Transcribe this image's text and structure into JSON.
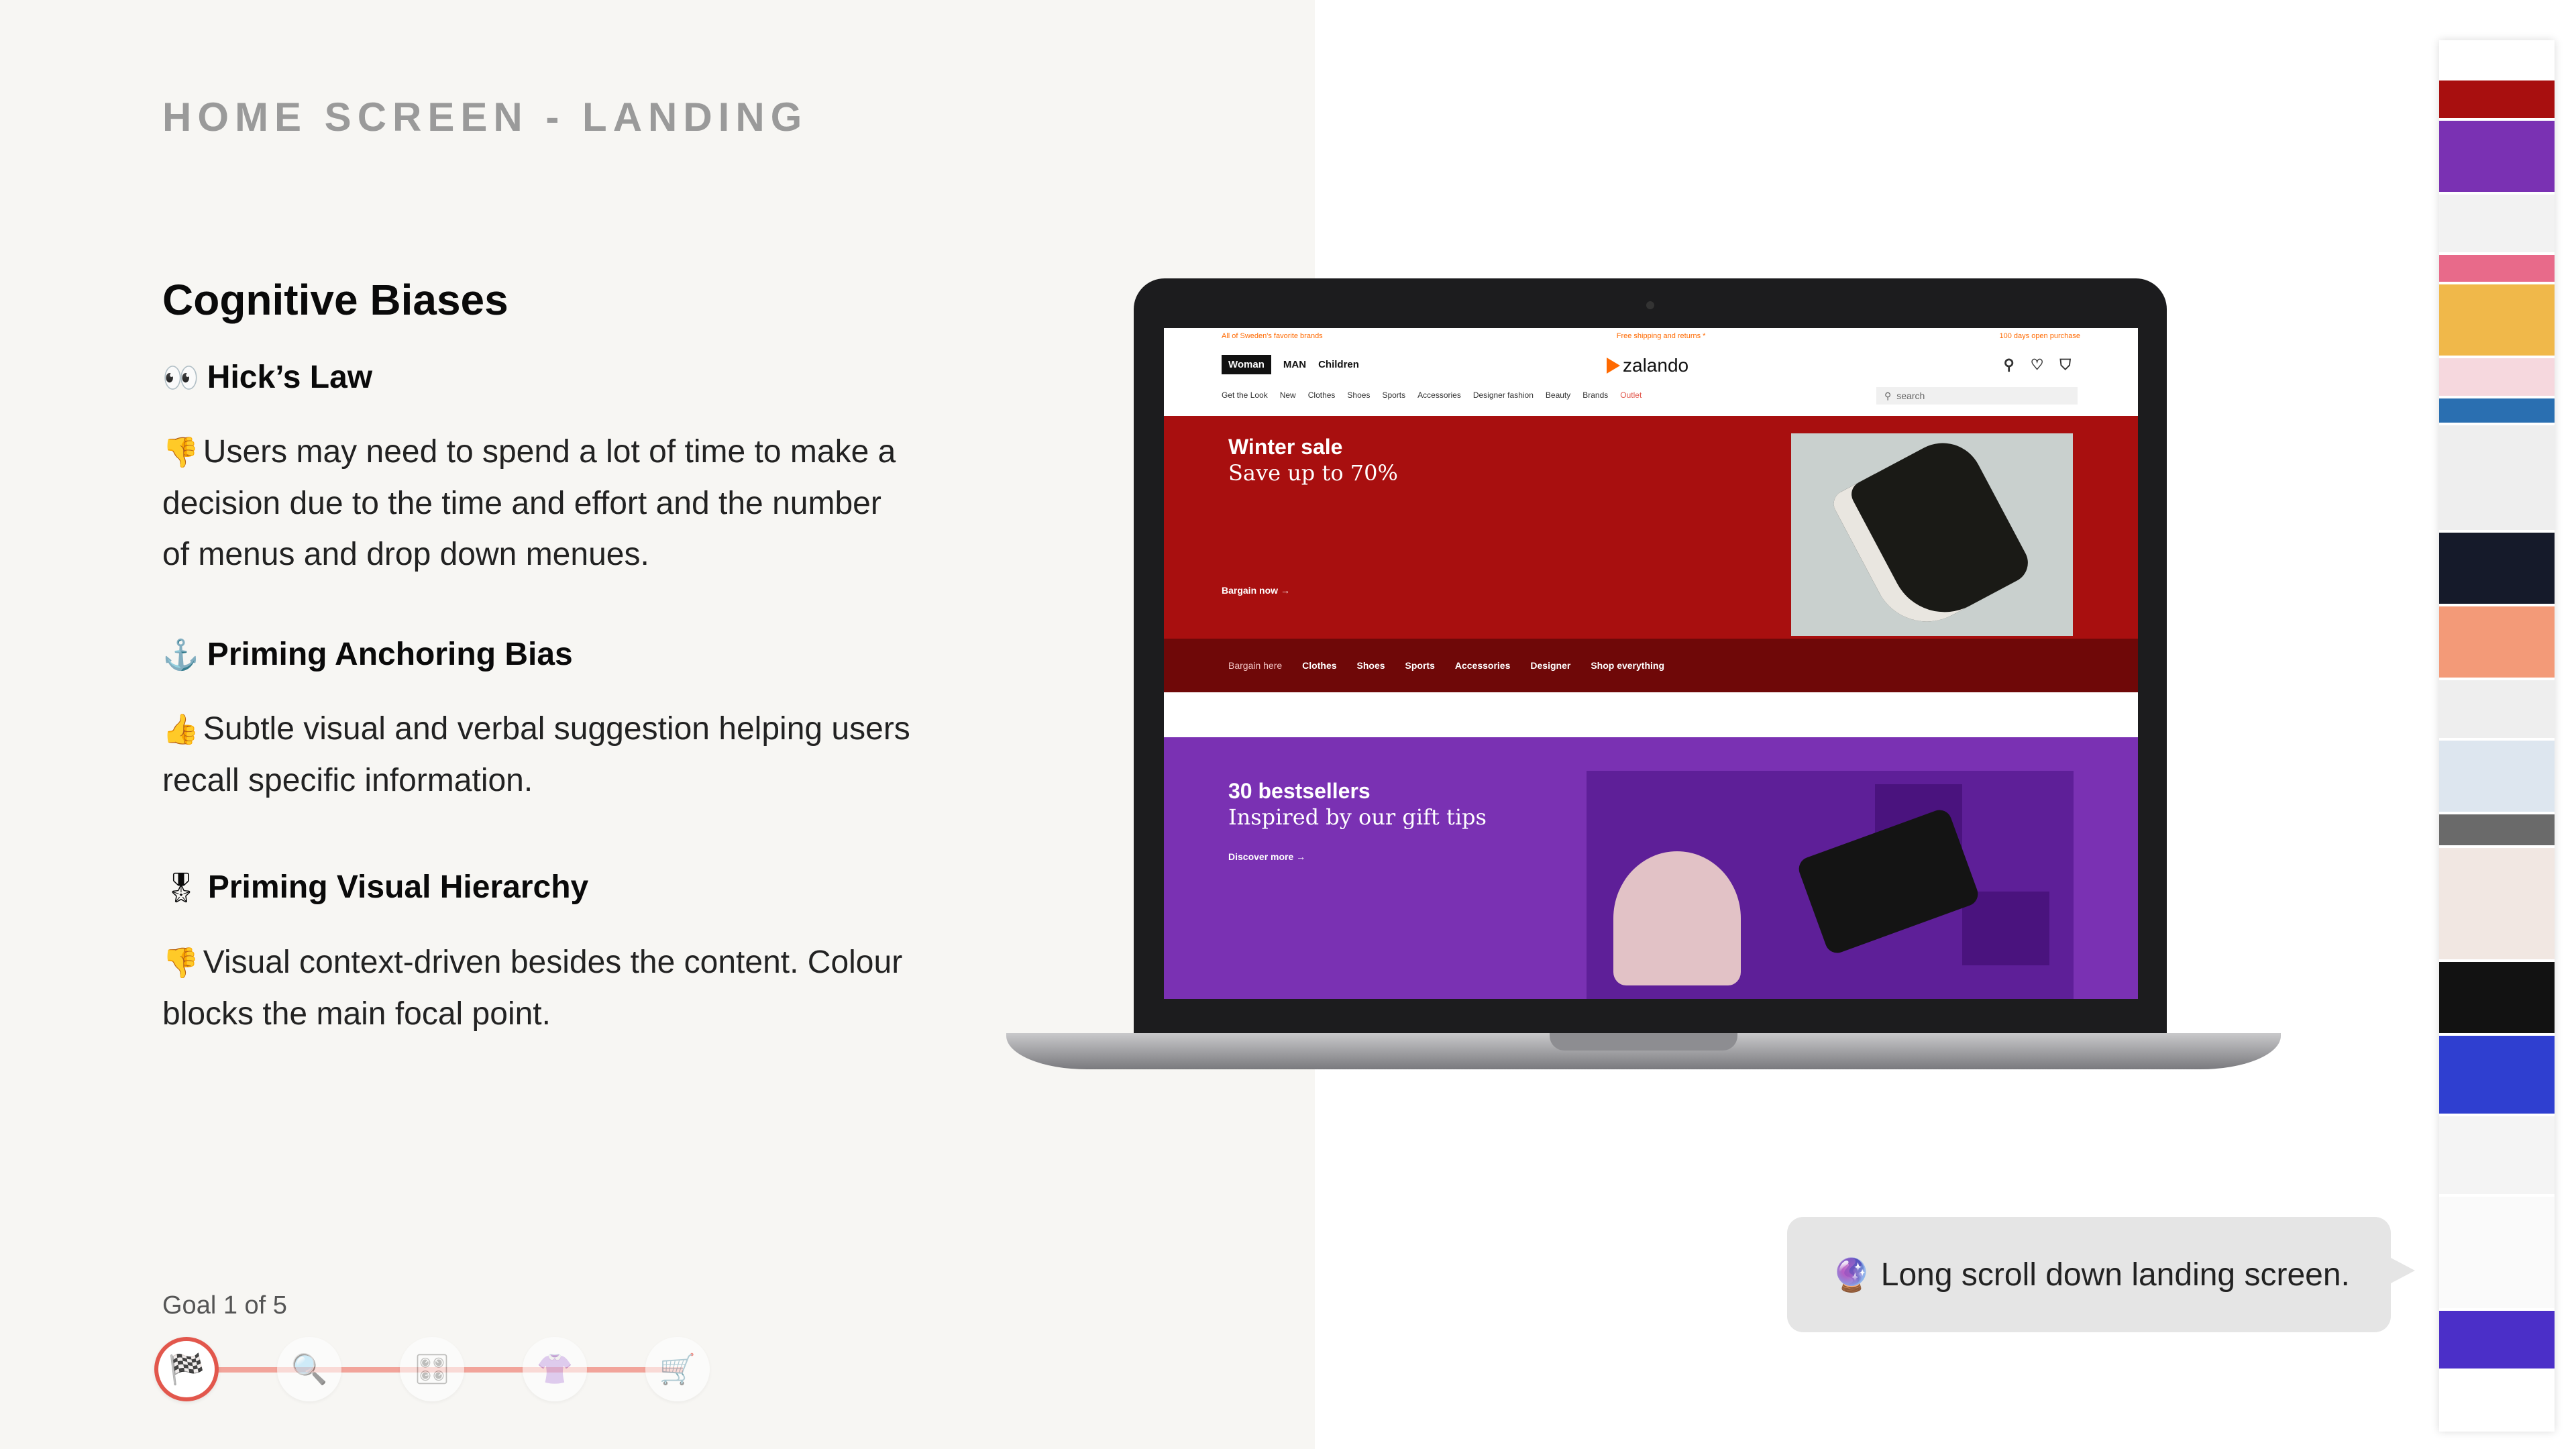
{
  "page": {
    "title": "HOME SCREEN - LANDING",
    "section_title": "Cognitive Biases"
  },
  "biases": [
    {
      "heading_emoji": "👀",
      "heading": "Hick’s Law",
      "desc_emoji": "👎",
      "desc": "Users may need to spend a lot of time to make a decision due to the time and effort and the number of menus and drop down menues."
    },
    {
      "heading_emoji": "⚓",
      "heading": "Priming Anchoring Bias",
      "desc_emoji": "👍",
      "desc": "Subtle visual and verbal suggestion helping users recall specific information."
    },
    {
      "heading_emoji": "🎖",
      "heading": "Priming Visual Hierarchy",
      "desc_emoji": "👎",
      "desc": "Visual context-driven besides the content. Colour blocks the main focal point."
    }
  ],
  "goal": {
    "label": "Goal 1 of 5",
    "steps": [
      {
        "icon": "🏁",
        "name": "finish-flag-icon",
        "active": true
      },
      {
        "icon": "🔍",
        "name": "search-icon",
        "active": false
      },
      {
        "icon": "🎛",
        "name": "filter-icon",
        "active": false
      },
      {
        "icon": "👚",
        "name": "blouse-icon",
        "active": false
      },
      {
        "icon": "🛒",
        "name": "cart-icon",
        "active": false
      }
    ]
  },
  "site": {
    "promo_left": "All of Sweden's favorite brands",
    "promo_mid": "Free shipping and returns *",
    "promo_right": "100 days open purchase",
    "gender_tabs": [
      "Woman",
      "MAN",
      "Children"
    ],
    "logo": "zalando",
    "categories": [
      "Get the Look",
      "New",
      "Clothes",
      "Shoes",
      "Sports",
      "Accessories",
      "Designer fashion",
      "Beauty",
      "Brands",
      "Outlet"
    ],
    "search_placeholder": "search",
    "winter": {
      "title": "Winter sale",
      "subtitle": "Save up to 70%",
      "cta": "Bargain now →",
      "sub_links": [
        "Bargain here",
        "Clothes",
        "Shoes",
        "Sports",
        "Accessories",
        "Designer",
        "Shop everything"
      ]
    },
    "bestsellers": {
      "title": "30 bestsellers",
      "subtitle": "Inspired by our gift tips",
      "cta": "Discover more →"
    }
  },
  "bubble": {
    "emoji": "🔮",
    "text": "Long scroll down landing screen."
  },
  "colors": {
    "winter_red": "#a80f0f",
    "purple": "#7a31b3",
    "accent_orange": "#ff6900",
    "progress_active": "#e2574c"
  }
}
